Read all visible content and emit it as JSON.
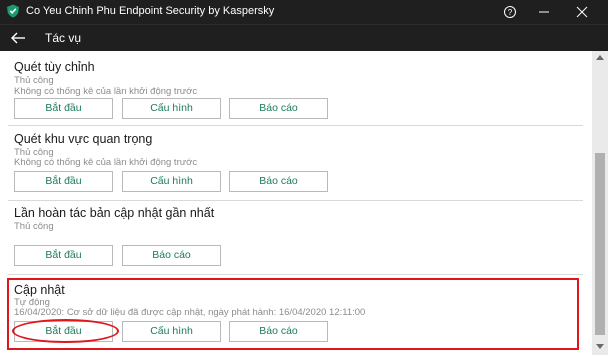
{
  "window": {
    "title": "Co Yeu Chinh Phu Endpoint Security by Kaspersky",
    "icons": {
      "logo": "kaspersky-shield-icon",
      "help": "help-icon",
      "minimize": "minimize-icon",
      "close": "close-icon"
    }
  },
  "nav": {
    "back_icon": "back-arrow-icon",
    "title": "Tác vụ"
  },
  "buttons": {
    "start": "Bắt đầu",
    "configure": "Cấu hình",
    "report": "Báo cáo"
  },
  "tasks": [
    {
      "name": "Quét tùy chỉnh",
      "mode": "Thủ công",
      "info": "Không có thống kê của lần khởi động trước"
    },
    {
      "name": "Quét khu vực quan trọng",
      "mode": "Thủ công",
      "info": "Không có thống kê của lần khởi động trước"
    },
    {
      "name": "Lần hoàn tác bản cập nhật gần nhất",
      "mode": "Thủ công"
    },
    {
      "name": "Cập nhật",
      "mode": "Tự động",
      "info": "16/04/2020: Cơ sở dữ liệu đã được cập nhật, ngày phát hành: 16/04/2020 12:11:00"
    }
  ],
  "annotations": {
    "color": "#e0161d"
  },
  "colors": {
    "titlebar": "#1f1f1f",
    "button_text": "#1c7a5e"
  }
}
